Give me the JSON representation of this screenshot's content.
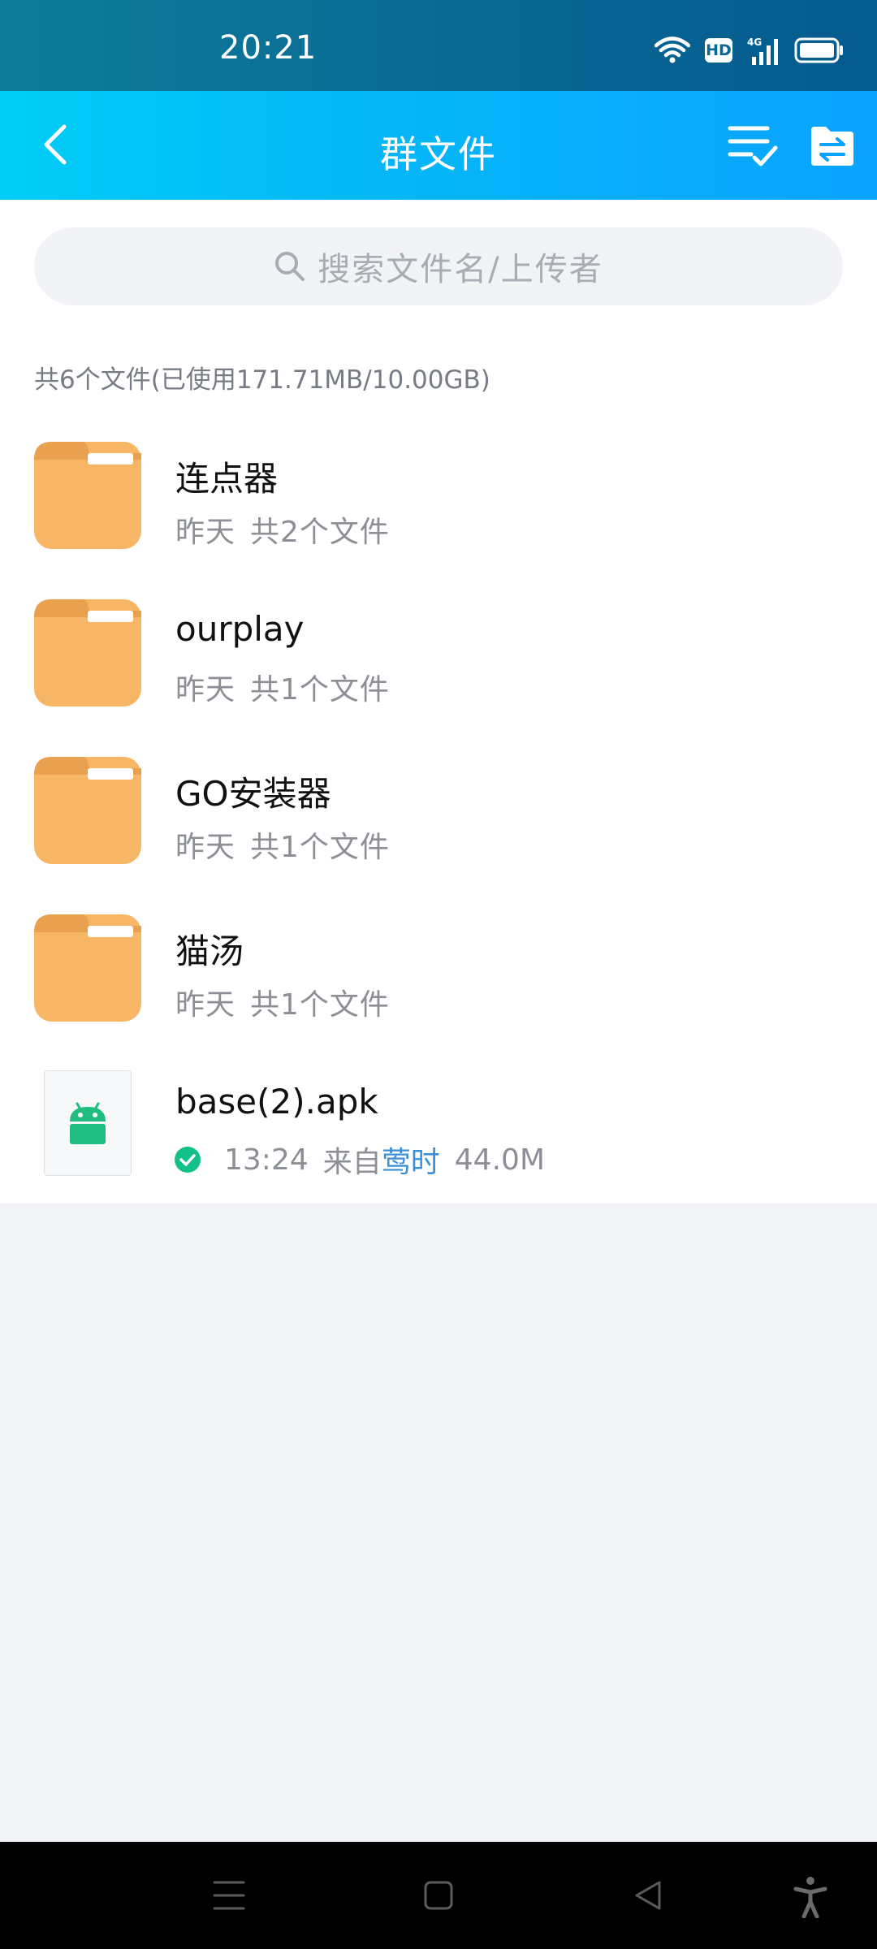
{
  "status_bar": {
    "time": "20:21",
    "icons": [
      "wifi-icon",
      "hd-badge",
      "4g-signal-icon",
      "battery-icon"
    ],
    "hd_label": "HD"
  },
  "nav": {
    "title": "群文件",
    "icons": [
      "back-icon",
      "multi-select-icon",
      "transfer-icon"
    ]
  },
  "search": {
    "placeholder": "搜索文件名/上传者"
  },
  "summary": "共6个文件(已使用171.71MB/10.00GB)",
  "folders": [
    {
      "name": "连点器",
      "date": "昨天",
      "count": "共2个文件"
    },
    {
      "name": "ourplay",
      "date": "昨天",
      "count": "共1个文件"
    },
    {
      "name": "GO安装器",
      "date": "昨天",
      "count": "共1个文件"
    },
    {
      "name": "猫汤",
      "date": "昨天",
      "count": "共1个文件"
    }
  ],
  "apk": {
    "name": "base(2).apk",
    "time": "13:24",
    "from_label": "来自",
    "uploader": "莺时",
    "size": "44.0M"
  },
  "colors": {
    "nav_gradient_start": "#00cdf6",
    "nav_gradient_end": "#0aa3ff",
    "folder": "#f7b666",
    "folder_dark": "#e9a04f",
    "android_green": "#1fbe80",
    "link_blue": "#3b8fd7",
    "check_green": "#14c08a"
  }
}
